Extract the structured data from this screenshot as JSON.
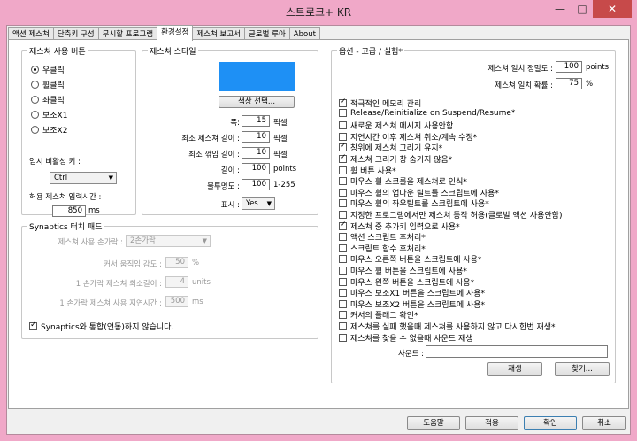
{
  "window": {
    "title": "스트로크+ KR",
    "minimize": "—",
    "maximize": "□",
    "close": "✕"
  },
  "tabs": [
    "액션 제스쳐",
    "단축키 구성",
    "무시할 프로그램",
    "환경설정",
    "제스쳐 보고서",
    "글로벌 루아",
    "About"
  ],
  "active_tab": 3,
  "gesture_button": {
    "label": "제스쳐 사용 버튼",
    "options": [
      "우클릭",
      "휠클릭",
      "좌클릭",
      "보조X1",
      "보조X2"
    ],
    "selected": 0,
    "disable_key_label": "임시 비활성 키 :",
    "disable_key_value": "Ctrl",
    "allowed_time_label": "허용 제스쳐 입력시간 :",
    "allowed_time_value": "850",
    "allowed_time_unit": "ms"
  },
  "gesture_style": {
    "label": "제스쳐 스타일",
    "color": "#1e90f5",
    "color_button": "색상 선택...",
    "rows": [
      {
        "label": "폭:",
        "value": "15",
        "unit": "픽셀"
      },
      {
        "label": "최소 제스쳐 길이 :",
        "value": "10",
        "unit": "픽셀"
      },
      {
        "label": "최소 꺾임 길이 :",
        "value": "10",
        "unit": "픽셀"
      },
      {
        "label": "길이 :",
        "value": "100",
        "unit": "points"
      },
      {
        "label": "불투명도 :",
        "value": "100",
        "unit": "1-255"
      }
    ],
    "display_label": "표시 :",
    "display_value": "Yes"
  },
  "synaptics": {
    "label": "Synaptics 터치 패드",
    "finger_label": "제스쳐 사용 손가락 :",
    "finger_value": "2손가락",
    "rows": [
      {
        "label": "커서 움직임 감도 :",
        "value": "50",
        "unit": "%"
      },
      {
        "label": "1 손가락 제스쳐 최소길이 :",
        "value": "4",
        "unit": "units"
      },
      {
        "label": "1 손가락 제스쳐 사용 지연시간 :",
        "value": "500",
        "unit": "ms"
      }
    ],
    "disable_check": "Synaptics와 통합(연동)하지 않습니다.",
    "disable_checked": true
  },
  "options": {
    "label": "옵션 - 고급 / 실험*",
    "precision_label": "제스쳐 일치 정밀도 :",
    "precision_value": "100",
    "precision_unit": "points",
    "probability_label": "제스쳐 일치 확률 :",
    "probability_value": "75",
    "probability_unit": "%",
    "checks": [
      {
        "label": "적극적인 메모리 관리",
        "checked": true
      },
      {
        "label": "Release/Reinitialize on Suspend/Resume*",
        "checked": false
      },
      {
        "label": "새로운 제스쳐 메시지 사용안함",
        "checked": false
      },
      {
        "label": "지연시간 이후 제스쳐 취소/계속 수정*",
        "checked": false
      },
      {
        "label": "창위에 제스쳐 그리기 유지*",
        "checked": true
      },
      {
        "label": "제스쳐 그리기 창 숨기지 않음*",
        "checked": true
      },
      {
        "label": "휠 버튼 사용*",
        "checked": false
      },
      {
        "label": "마우스 휠 스크롤을 제스쳐로 인식*",
        "checked": false
      },
      {
        "label": "마우스 휠의 업다운 틸트를 스크립트에 사용*",
        "checked": false
      },
      {
        "label": "마우스 휠의 좌우틸트를 스크립트에 사용*",
        "checked": false
      },
      {
        "label": "지정한 프로그램에서만 제스쳐 동작 허용(글로벌 액션 사용안함)",
        "checked": false
      },
      {
        "label": "제스쳐 중 추가키 입력으로 사용*",
        "checked": true
      },
      {
        "label": "액션 스크립트 후처리*",
        "checked": false
      },
      {
        "label": "스크립트 함수 후처리*",
        "checked": false
      },
      {
        "label": "마우스 오른쪽 버튼을 스크립트에 사용*",
        "checked": false
      },
      {
        "label": "마우스 휠 버튼을 스크립트에 사용*",
        "checked": false
      },
      {
        "label": "마우스 왼쪽 버튼을 스크립트에 사용*",
        "checked": false
      },
      {
        "label": "마우스 보조X1 버튼을 스크립트에 사용*",
        "checked": false
      },
      {
        "label": "마우스 보조X2 버튼을 스크립트에 사용*",
        "checked": false
      },
      {
        "label": "커서의 플래그 확인*",
        "checked": false
      },
      {
        "label": "제스쳐를 실패 했을때 제스쳐를 사용하지 않고 다시한번 재생*",
        "checked": false
      },
      {
        "label": "제스쳐를 찾을 수 없을때 사운드 재생",
        "checked": false
      }
    ],
    "sound_label": "사운드 :",
    "sound_value": "",
    "play_button": "재생",
    "browse_button": "찾기..."
  },
  "bottom_buttons": {
    "help": "도움말",
    "apply": "적용",
    "ok": "확인",
    "cancel": "취소"
  }
}
